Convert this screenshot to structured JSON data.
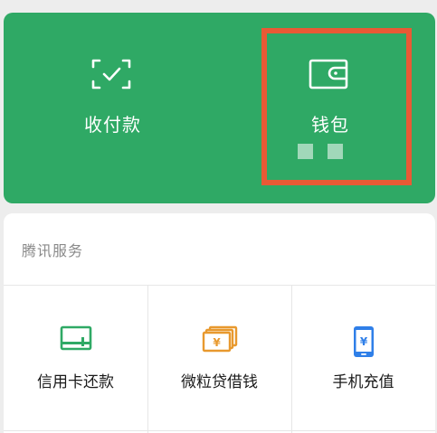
{
  "top": {
    "receive_pay": {
      "label": "收付款",
      "icon": "scan-check-icon"
    },
    "wallet": {
      "label": "钱包",
      "icon": "wallet-icon"
    }
  },
  "services": {
    "title": "腾讯服务",
    "items": [
      {
        "label": "信用卡还款",
        "icon": "credit-card-icon",
        "color": "#2fa965"
      },
      {
        "label": "微粒贷借钱",
        "icon": "loan-bills-icon",
        "color": "#e8992e"
      },
      {
        "label": "手机充值",
        "icon": "phone-recharge-icon",
        "color": "#2f7fe8"
      }
    ]
  },
  "colors": {
    "brand_green": "#2fa965",
    "highlight": "#e85a35",
    "background": "#ededed"
  }
}
